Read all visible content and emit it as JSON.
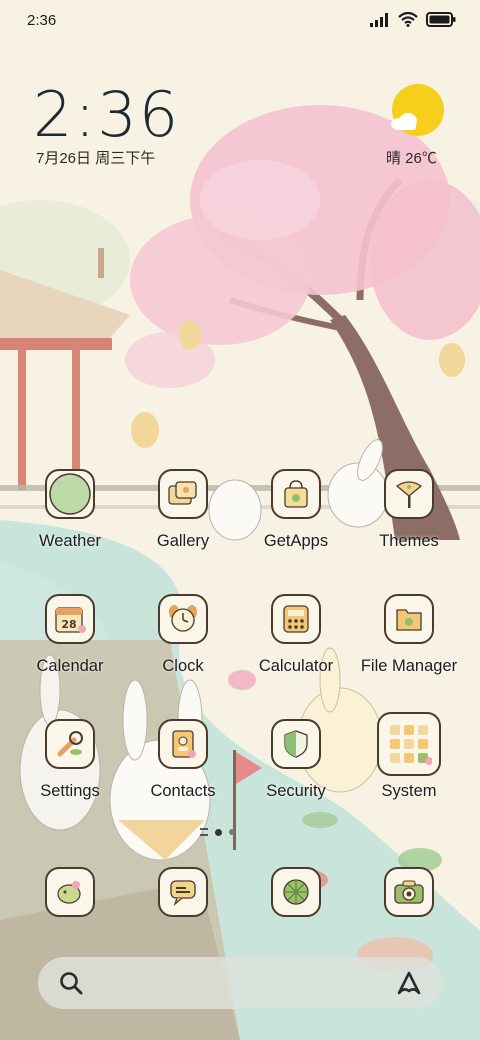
{
  "status": {
    "time": "2:36"
  },
  "clock": {
    "time": "2:36",
    "date": "7月26日 周三下午"
  },
  "weather": {
    "text": "晴 26℃"
  },
  "apps": [
    {
      "label": "Weather"
    },
    {
      "label": "Gallery"
    },
    {
      "label": "GetApps"
    },
    {
      "label": "Themes"
    },
    {
      "label": "Calendar"
    },
    {
      "label": "Clock"
    },
    {
      "label": "Calculator"
    },
    {
      "label": "File Manager"
    },
    {
      "label": "Settings"
    },
    {
      "label": "Contacts"
    },
    {
      "label": "Security"
    },
    {
      "label": "System"
    }
  ],
  "calendar_icon_text": "28",
  "dock": [
    "chat-bird-icon",
    "messages-icon",
    "browser-icon",
    "camera-icon"
  ],
  "search": {
    "icon": "search-icon",
    "assistant": "triangle-logo-icon"
  },
  "colors": {
    "sun": "#f6cf1c",
    "blossom": "#f4c2cf",
    "water": "#bde1d8"
  }
}
